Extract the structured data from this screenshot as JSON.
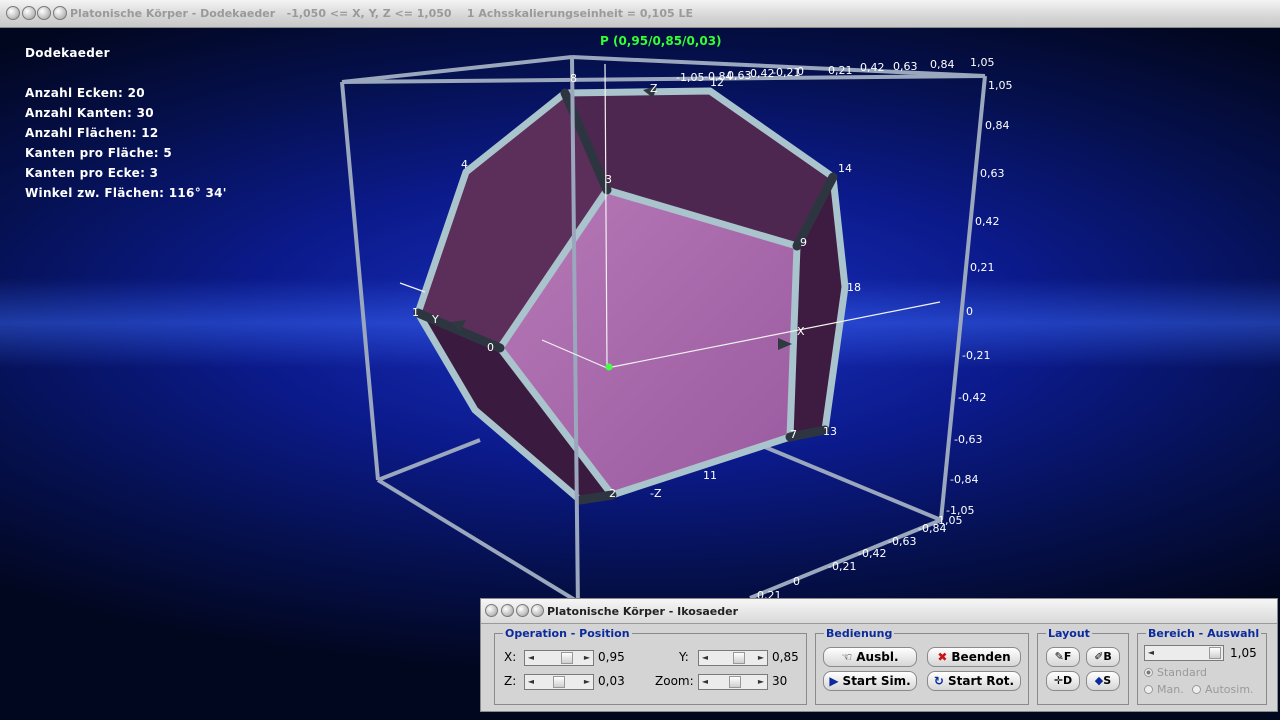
{
  "window": {
    "title": "Platonische Körper - Dodekaeder   -1,050 <= X, Y, Z <= 1,050    1 Achsskalierungseinheit = 0,105 LE"
  },
  "info": {
    "name": "Dodekaeder",
    "lines": [
      "Anzahl Ecken: 20",
      "Anzahl Kanten: 30",
      "Anzahl Flächen: 12",
      "Kanten pro Fläche: 5",
      "Kanten pro Ecke: 3",
      "Winkel zw. Flächen: 116° 34'"
    ]
  },
  "point_label": "P (0,95/0,85/0,03)",
  "axis_names": {
    "x": "X",
    "y": "Y",
    "z": "Z",
    "neg_z": "-Z"
  },
  "top_ticks": [
    "-1,05",
    "-0,84",
    "0,63",
    "-0,42",
    "-0,21",
    "0",
    "0,21",
    "0,42",
    "0,63",
    "0,84",
    "1,05"
  ],
  "right_ticks": [
    "1,05",
    "0,84",
    "0,63",
    "0,42",
    "0,21",
    "0",
    "-0,21",
    "-0,42",
    "-0,63",
    "-0,84",
    "-1,05"
  ],
  "bottom_ticks": [
    "1,05",
    "-0,84",
    "-0,63",
    "-0,42",
    "-0,21",
    "0",
    "0,21"
  ],
  "vertex_labels": [
    "0",
    "1",
    "2",
    "3",
    "4",
    "7",
    "8",
    "9",
    "11",
    "12",
    "13",
    "14",
    "18"
  ],
  "panel": {
    "title": "Platonische Körper - Ikosaeder",
    "operation": {
      "title": "Operation - Position",
      "x_label": "X:",
      "x_value": "0,95",
      "y_label": "Y:",
      "y_value": "0,85",
      "z_label": "Z:",
      "z_value": "0,03",
      "zoom_label": "Zoom:",
      "zoom_value": "30"
    },
    "bedienung": {
      "title": "Bedienung",
      "ausbl": "Ausbl.",
      "beenden": "Beenden",
      "start_sim": "Start Sim.",
      "start_rot": "Start Rot."
    },
    "layout": {
      "title": "Layout",
      "f": "F",
      "b": "B",
      "d": "D",
      "s": "S"
    },
    "bereich": {
      "title": "Bereich - Auswahl",
      "value": "1,05",
      "standard": "Standard",
      "man": "Man.",
      "autosim": "Autosim."
    }
  }
}
